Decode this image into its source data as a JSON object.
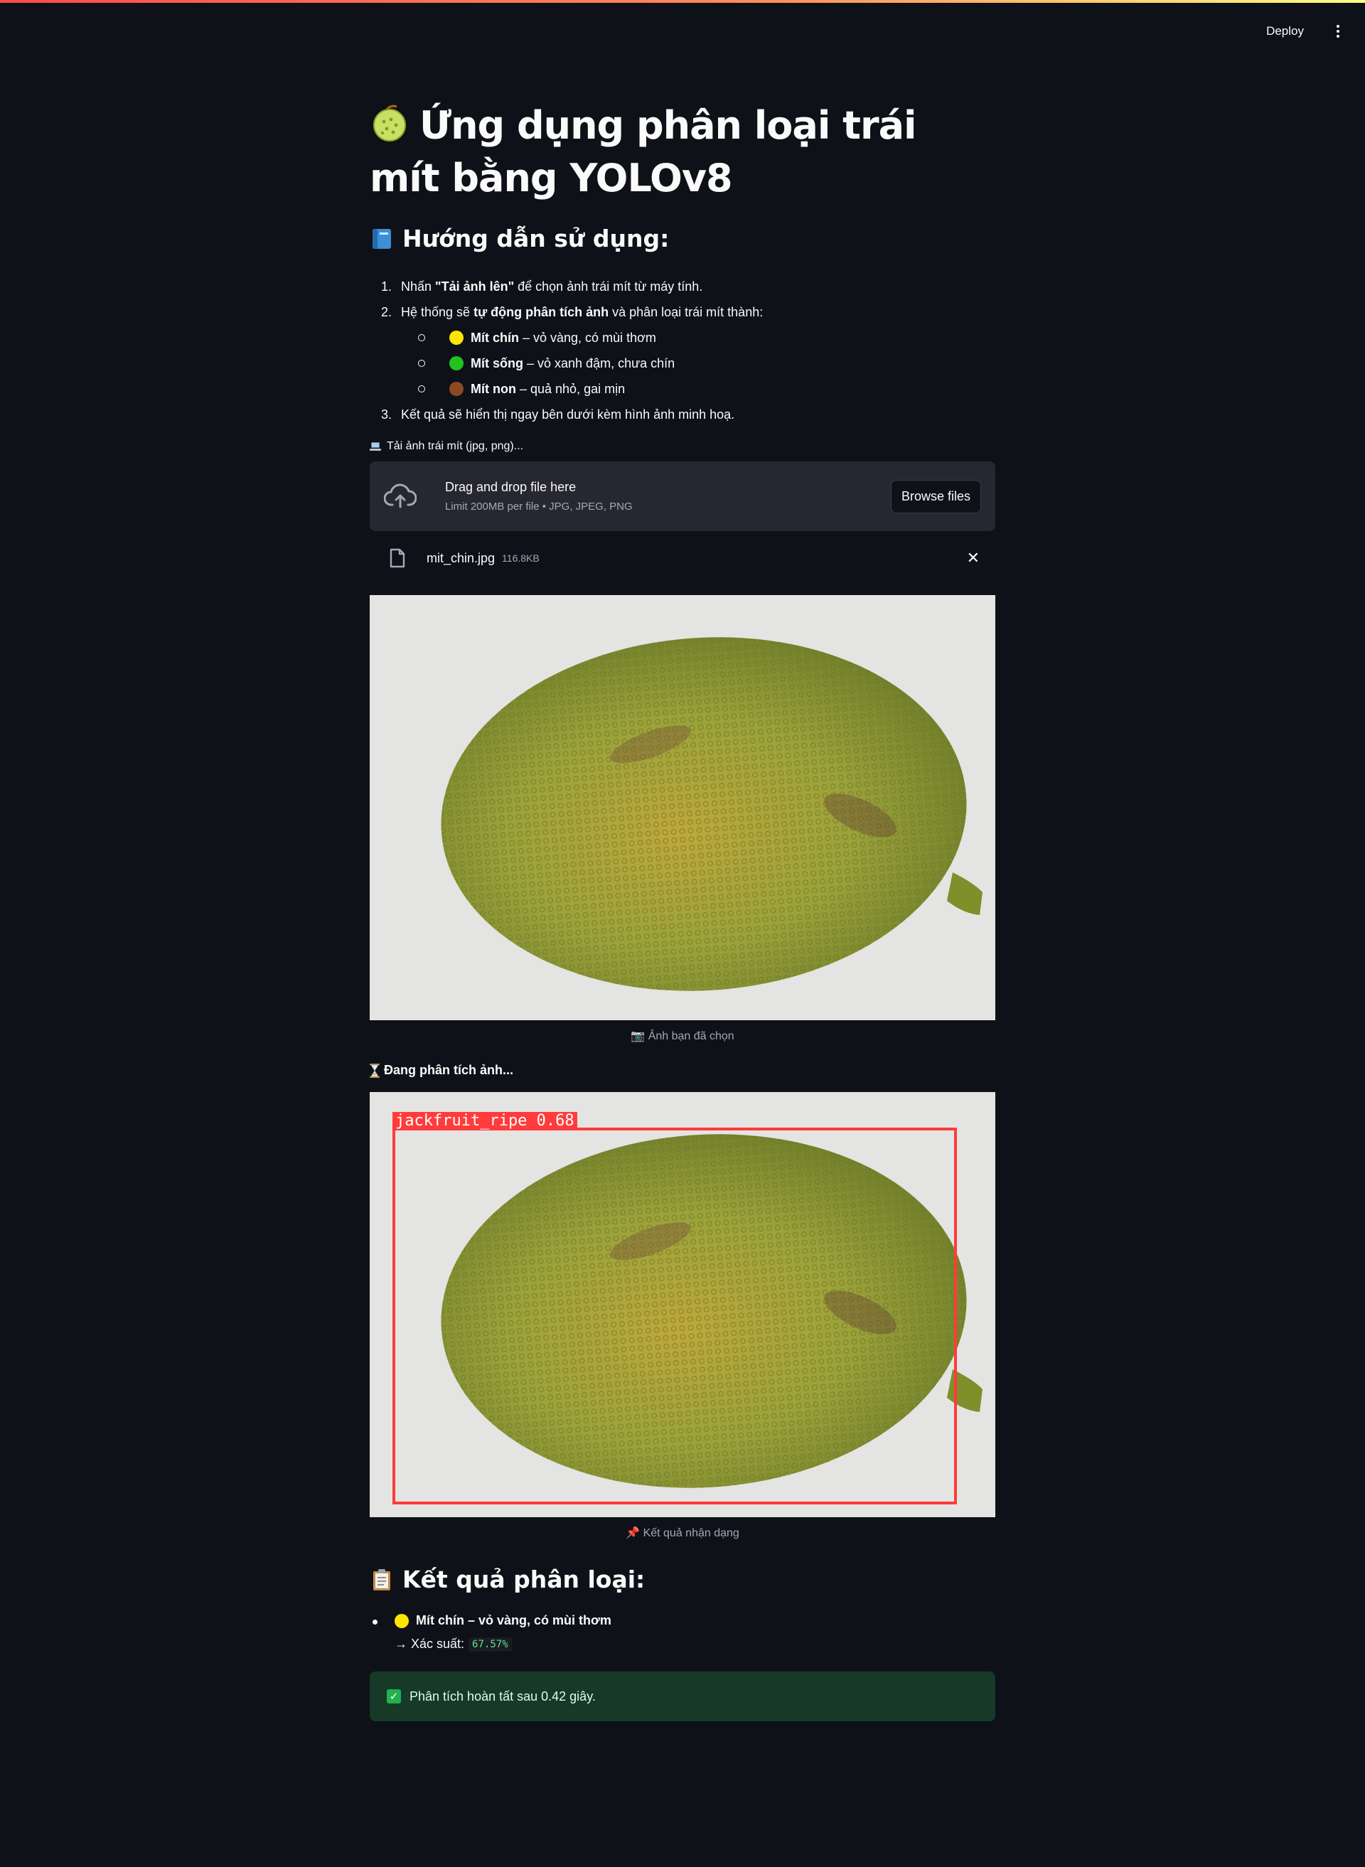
{
  "header": {
    "deploy_label": "Deploy",
    "menu_icon": "more-vertical-icon"
  },
  "title": {
    "emoji": "melon-emoji",
    "text": "Ứng dụng phân loại trái mít bằng YOLOv8"
  },
  "guide": {
    "emoji": "blue-book-emoji",
    "title": "Hướng dẫn sử dụng:",
    "step1": {
      "prefix": "Nhấn ",
      "bold": "\"Tải ảnh lên\"",
      "suffix": " để chọn ảnh trái mít từ máy tính."
    },
    "step2": {
      "prefix": "Hệ thống sẽ ",
      "bold": "tự động phân tích ảnh",
      "suffix": " và phân loại trái mít thành:"
    },
    "classes": [
      {
        "color": "#ffe600",
        "name": "Mít chín",
        "desc": " – vỏ vàng, có mùi thơm"
      },
      {
        "color": "#22c21f",
        "name": "Mít sống",
        "desc": " – vỏ xanh đậm, chưa chín"
      },
      {
        "color": "#8b4a22",
        "name": "Mít non",
        "desc": " – quả nhỏ, gai mịn"
      }
    ],
    "step3": "Kết quả sẽ hiển thị ngay bên dưới kèm hình ảnh minh hoạ."
  },
  "uploader": {
    "label_icon": "laptop-emoji",
    "label": "Tải ảnh trái mít (jpg, png)...",
    "drop_title": "Drag and drop file here",
    "drop_sub": "Limit 200MB per file • JPG, JPEG, PNG",
    "browse_label": "Browse files",
    "file_name": "mit_chin.jpg",
    "file_size": "116.8KB"
  },
  "preview": {
    "caption_icon": "camera-emoji",
    "caption": "Ảnh bạn đã chọn"
  },
  "analyzing": {
    "icon": "hourglass-emoji",
    "text": "Đang phân tích ảnh..."
  },
  "detection": {
    "label": "jackfruit_ripe  0.68",
    "box_color": "#ff3b3b",
    "caption_icon": "pushpin-emoji",
    "caption": "Kết quả nhận dạng"
  },
  "results": {
    "emoji": "clipboard-emoji",
    "title": "Kết quả phân loại:",
    "item": {
      "color": "#ffe600",
      "text": "Mít chín – vỏ vàng, có mùi thơm"
    },
    "prob_label": "→ Xác suất:",
    "prob_value": "67.57%"
  },
  "success": {
    "icon": "check-mark-emoji",
    "text": "Phân tích hoàn tất sau 0.42 giây."
  },
  "colors": {
    "background": "#0e1117",
    "dropzone": "#262730",
    "success_bg": "#173928",
    "code_text": "#5ce488"
  }
}
